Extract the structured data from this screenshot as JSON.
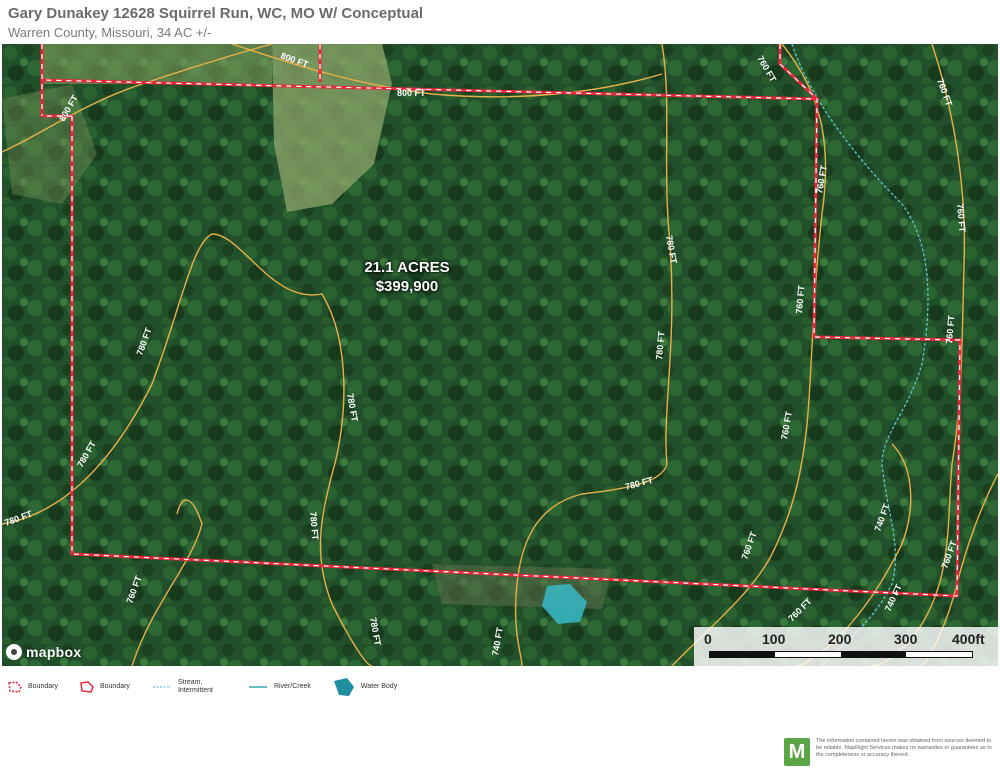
{
  "header": {
    "title": "Gary Dunakey 12628 Squirrel Run, WC, MO W/ Conceptual",
    "subtitle": "Warren County, Missouri, 34 AC +/-"
  },
  "map": {
    "parcel_label_line1": "21.1 ACRES",
    "parcel_label_line2": "$399,900",
    "attribution": "mapbox",
    "contour_labels": [
      "800 FT",
      "800 FT",
      "800 FT",
      "760 FT",
      "760 FT",
      "760 FT",
      "760 FT",
      "760 FT",
      "760 FT",
      "760 FT",
      "760 FT",
      "760 FT",
      "760 FT",
      "760 FT",
      "780 FT",
      "780 FT",
      "780 FT",
      "780 FT",
      "780 FT",
      "780 FT",
      "780 FT",
      "780 FT",
      "780 FT",
      "740 FT",
      "740 FT",
      "740 FT"
    ],
    "colors": {
      "boundary": "#e8283a",
      "contour": "#e8b04a",
      "stream": "#5fc5d0",
      "water": "#38b9c8",
      "forest": "#1f4a22"
    }
  },
  "scale": {
    "labels": [
      "0",
      "100",
      "200",
      "300",
      "400ft"
    ]
  },
  "legend": {
    "items": [
      {
        "label": "Boundary",
        "icon": "boundary-dashed-icon"
      },
      {
        "label": "Boundary",
        "icon": "boundary-solid-icon"
      },
      {
        "label": "Stream, Intermittent",
        "icon": "stream-icon"
      },
      {
        "label": "River/Creek",
        "icon": "river-icon"
      },
      {
        "label": "Water Body",
        "icon": "water-body-icon"
      }
    ]
  },
  "footer": {
    "logo_letter": "M",
    "disclaimer": "The information contained herein was obtained from sources deemed to be reliable. MapRight Services makes no warranties or guarantees as to the completeness or accuracy thereof."
  }
}
